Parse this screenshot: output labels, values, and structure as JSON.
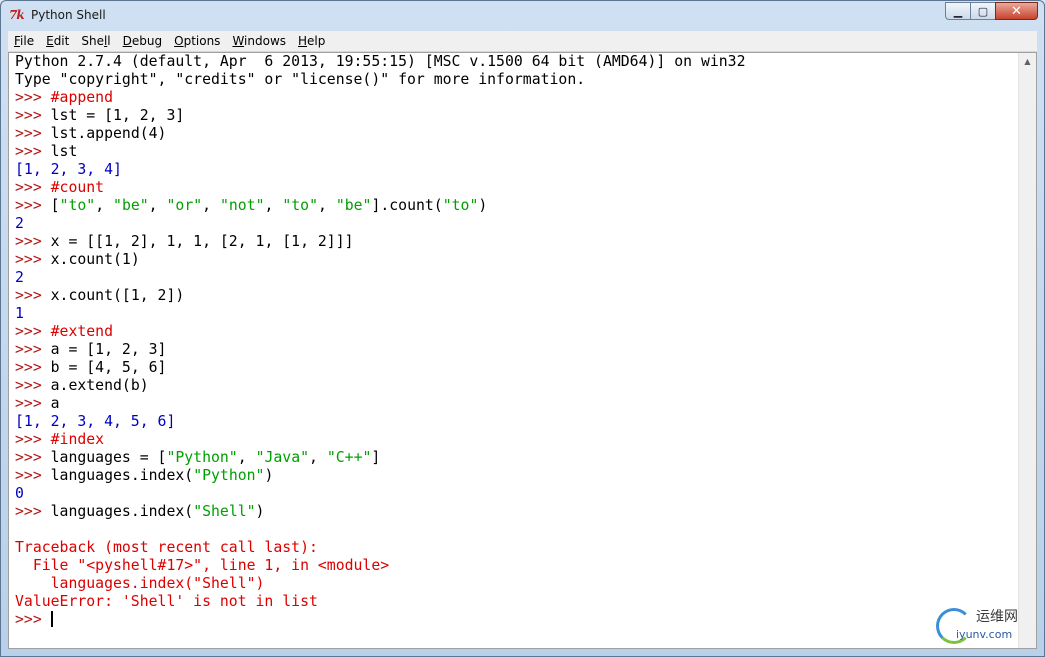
{
  "window": {
    "title": "Python Shell",
    "app_icon_text": "7k",
    "controls": {
      "minimize": "▁",
      "maximize": "▢",
      "close": "✕"
    }
  },
  "menubar": {
    "items": [
      {
        "first": "F",
        "rest": "ile"
      },
      {
        "first": "E",
        "rest": "dit"
      },
      {
        "first": "She",
        "rest": "ll",
        "underline_char": "l",
        "pre": "She",
        "post": "l"
      },
      {
        "first": "D",
        "rest": "ebug"
      },
      {
        "first": "O",
        "rest": "ptions"
      },
      {
        "first": "W",
        "rest": "indows"
      },
      {
        "first": "H",
        "rest": "elp"
      }
    ]
  },
  "shell": {
    "lines": [
      [
        {
          "c": "default",
          "t": "Python 2.7.4 (default, Apr  6 2013, 19:55:15) [MSC v.1500 64 bit (AMD64)] on win32"
        }
      ],
      [
        {
          "c": "default",
          "t": "Type \"copyright\", \"credits\" or \"license()\" for more information."
        }
      ],
      [
        {
          "c": "prompt",
          "t": ">>> "
        },
        {
          "c": "comment",
          "t": "#append"
        }
      ],
      [
        {
          "c": "prompt",
          "t": ">>> "
        },
        {
          "c": "default",
          "t": "lst = [1, 2, 3]"
        }
      ],
      [
        {
          "c": "prompt",
          "t": ">>> "
        },
        {
          "c": "default",
          "t": "lst.append(4)"
        }
      ],
      [
        {
          "c": "prompt",
          "t": ">>> "
        },
        {
          "c": "default",
          "t": "lst"
        }
      ],
      [
        {
          "c": "out",
          "t": "[1, 2, 3, 4]"
        }
      ],
      [
        {
          "c": "prompt",
          "t": ">>> "
        },
        {
          "c": "comment",
          "t": "#count"
        }
      ],
      [
        {
          "c": "prompt",
          "t": ">>> "
        },
        {
          "c": "default",
          "t": "["
        },
        {
          "c": "str",
          "t": "\"to\""
        },
        {
          "c": "default",
          "t": ", "
        },
        {
          "c": "str",
          "t": "\"be\""
        },
        {
          "c": "default",
          "t": ", "
        },
        {
          "c": "str",
          "t": "\"or\""
        },
        {
          "c": "default",
          "t": ", "
        },
        {
          "c": "str",
          "t": "\"not\""
        },
        {
          "c": "default",
          "t": ", "
        },
        {
          "c": "str",
          "t": "\"to\""
        },
        {
          "c": "default",
          "t": ", "
        },
        {
          "c": "str",
          "t": "\"be\""
        },
        {
          "c": "default",
          "t": "].count("
        },
        {
          "c": "str",
          "t": "\"to\""
        },
        {
          "c": "default",
          "t": ")"
        }
      ],
      [
        {
          "c": "out",
          "t": "2"
        }
      ],
      [
        {
          "c": "prompt",
          "t": ">>> "
        },
        {
          "c": "default",
          "t": "x = [[1, 2], 1, 1, [2, 1, [1, 2]]]"
        }
      ],
      [
        {
          "c": "prompt",
          "t": ">>> "
        },
        {
          "c": "default",
          "t": "x.count(1)"
        }
      ],
      [
        {
          "c": "out",
          "t": "2"
        }
      ],
      [
        {
          "c": "prompt",
          "t": ">>> "
        },
        {
          "c": "default",
          "t": "x.count([1, 2])"
        }
      ],
      [
        {
          "c": "out",
          "t": "1"
        }
      ],
      [
        {
          "c": "prompt",
          "t": ">>> "
        },
        {
          "c": "comment",
          "t": "#extend"
        }
      ],
      [
        {
          "c": "prompt",
          "t": ">>> "
        },
        {
          "c": "default",
          "t": "a = [1, 2, 3]"
        }
      ],
      [
        {
          "c": "prompt",
          "t": ">>> "
        },
        {
          "c": "default",
          "t": "b = [4, 5, 6]"
        }
      ],
      [
        {
          "c": "prompt",
          "t": ">>> "
        },
        {
          "c": "default",
          "t": "a.extend(b)"
        }
      ],
      [
        {
          "c": "prompt",
          "t": ">>> "
        },
        {
          "c": "default",
          "t": "a"
        }
      ],
      [
        {
          "c": "out",
          "t": "[1, 2, 3, 4, 5, 6]"
        }
      ],
      [
        {
          "c": "prompt",
          "t": ">>> "
        },
        {
          "c": "comment",
          "t": "#index"
        }
      ],
      [
        {
          "c": "prompt",
          "t": ">>> "
        },
        {
          "c": "default",
          "t": "languages = ["
        },
        {
          "c": "str",
          "t": "\"Python\""
        },
        {
          "c": "default",
          "t": ", "
        },
        {
          "c": "str",
          "t": "\"Java\""
        },
        {
          "c": "default",
          "t": ", "
        },
        {
          "c": "str",
          "t": "\"C++\""
        },
        {
          "c": "default",
          "t": "]"
        }
      ],
      [
        {
          "c": "prompt",
          "t": ">>> "
        },
        {
          "c": "default",
          "t": "languages.index("
        },
        {
          "c": "str",
          "t": "\"Python\""
        },
        {
          "c": "default",
          "t": ")"
        }
      ],
      [
        {
          "c": "out",
          "t": "0"
        }
      ],
      [
        {
          "c": "prompt",
          "t": ">>> "
        },
        {
          "c": "default",
          "t": "languages.index("
        },
        {
          "c": "str",
          "t": "\"Shell\""
        },
        {
          "c": "default",
          "t": ")"
        }
      ],
      [],
      [
        {
          "c": "err",
          "t": "Traceback (most recent call last):"
        }
      ],
      [
        {
          "c": "err",
          "t": "  File \"<pyshell#17>\", line 1, in <module>"
        }
      ],
      [
        {
          "c": "err",
          "t": "    languages.index(\"Shell\")"
        }
      ],
      [
        {
          "c": "err",
          "t": "ValueError: 'Shell' is not in list"
        }
      ]
    ],
    "current_prompt": ">>> "
  },
  "watermark": {
    "title": "运维网",
    "subtitle": "iyunv.com"
  },
  "colors": {
    "prompt": "#b01818",
    "string": "#00a000",
    "output": "#0000c0",
    "error": "#dd0000",
    "comment": "#dd0000"
  }
}
